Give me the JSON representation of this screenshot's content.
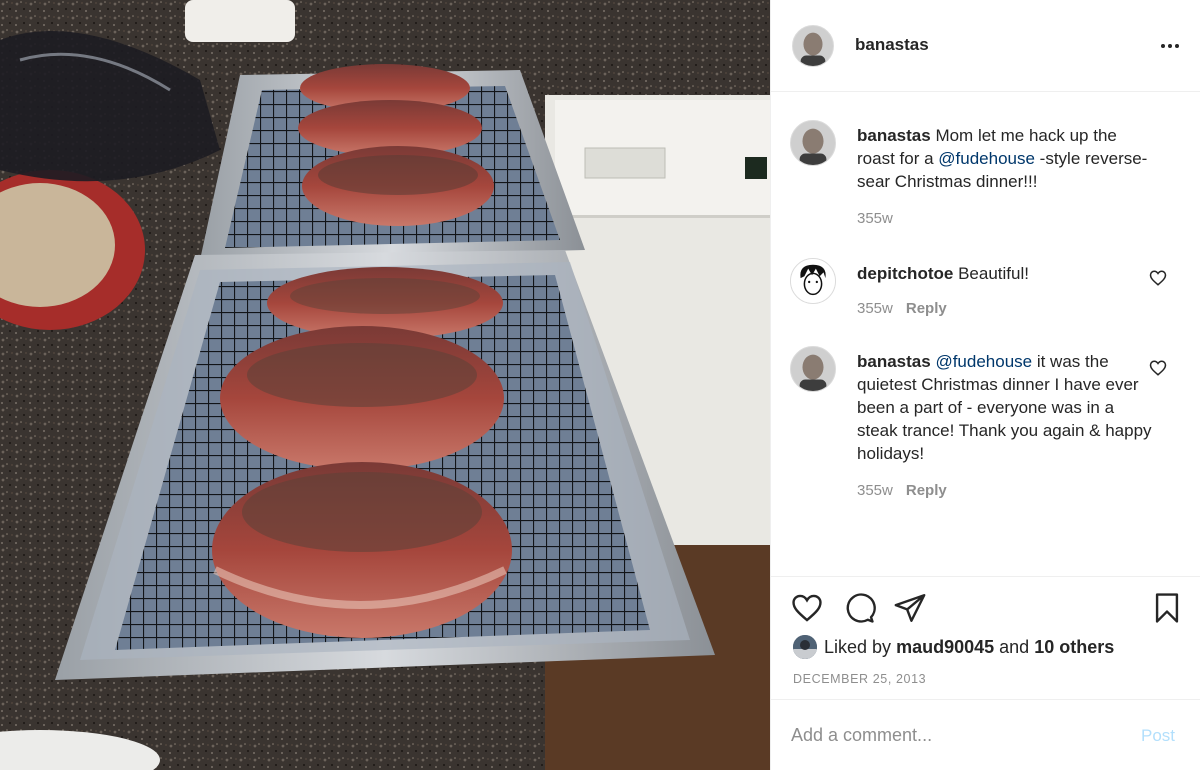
{
  "post": {
    "author": "banastas",
    "more_icon": "more-horizontal-icon"
  },
  "comments": [
    {
      "user": "banastas",
      "parts": [
        "Mom let me hack up the roast for a ",
        "@fudehouse",
        " -style reverse-sear Christmas dinner!!!"
      ],
      "time": "355w",
      "reply": ""
    },
    {
      "user": "depitchotoe",
      "parts": [
        "Beautiful!",
        "",
        ""
      ],
      "time": "355w",
      "reply": "Reply"
    },
    {
      "user": "banastas",
      "parts": [
        "",
        "@fudehouse",
        " it was the quietest Christmas dinner I have ever been a part of - everyone was in a steak trance! Thank you again & happy holidays!"
      ],
      "time": "355w",
      "reply": "Reply"
    }
  ],
  "actions": {
    "like_icon": "heart-icon",
    "comment_icon": "comment-bubble-icon",
    "share_icon": "paper-plane-icon",
    "save_icon": "bookmark-icon"
  },
  "likes": {
    "prefix": "Liked by",
    "user": "maud90045",
    "joiner": "and",
    "others": "10 others"
  },
  "date": "DECEMBER 25, 2013",
  "add_comment": {
    "placeholder": "Add a comment...",
    "post_label": "Post"
  },
  "colors": {
    "link": "#00376b",
    "muted": "#8e8e8e",
    "post_disabled": "#b2dffc",
    "text": "#262626"
  }
}
